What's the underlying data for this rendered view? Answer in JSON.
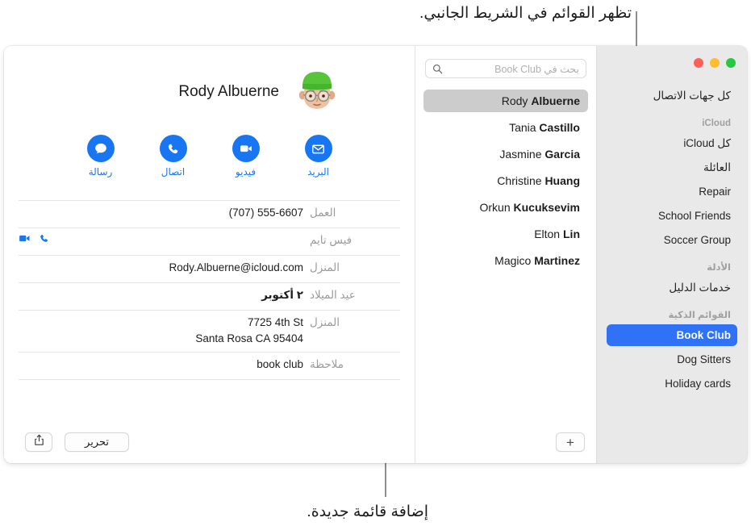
{
  "callouts": {
    "top": "تظهر القوائم في الشريط الجانبي.",
    "bottom": "إضافة قائمة جديدة."
  },
  "window": {
    "traffic_lights": [
      {
        "name": "close",
        "color": "#28c840"
      },
      {
        "name": "minimize",
        "color": "#febc2e"
      },
      {
        "name": "zoom",
        "color": "#ff5f57"
      }
    ]
  },
  "sidebar": {
    "all_contacts": "كل جهات الاتصال",
    "groups": [
      {
        "header": "iCloud",
        "items": [
          {
            "label": "كل iCloud",
            "selected": false
          },
          {
            "label": "العائلة",
            "selected": false
          },
          {
            "label": "Repair",
            "selected": false
          },
          {
            "label": "School Friends",
            "selected": false
          },
          {
            "label": "Soccer Group",
            "selected": false
          }
        ]
      },
      {
        "header": "الأدلة",
        "items": [
          {
            "label": "خدمات الدليل",
            "selected": false
          }
        ]
      },
      {
        "header": "القوائم الذكية",
        "items": [
          {
            "label": "Book Club",
            "selected": true
          },
          {
            "label": "Dog Sitters",
            "selected": false
          },
          {
            "label": "Holiday cards",
            "selected": false
          }
        ]
      }
    ]
  },
  "search": {
    "placeholder": "بحث في Book Club",
    "value": "",
    "icon": "search-icon"
  },
  "contacts": [
    {
      "first": "Rody",
      "last": "Albuerne",
      "selected": true
    },
    {
      "first": "Tania",
      "last": "Castillo",
      "selected": false
    },
    {
      "first": "Jasmine",
      "last": "Garcia",
      "selected": false
    },
    {
      "first": "Christine",
      "last": "Huang",
      "selected": false
    },
    {
      "first": "Orkun",
      "last": "Kucuksevim",
      "selected": false
    },
    {
      "first": "Elton",
      "last": "Lin",
      "selected": false
    },
    {
      "first": "Magico",
      "last": "Martinez",
      "selected": false
    }
  ],
  "detail": {
    "name": "Rody Albuerne",
    "avatar": "memoji-avatar",
    "actions": [
      {
        "label": "البريد",
        "icon": "mail-icon"
      },
      {
        "label": "فيديو",
        "icon": "video-icon"
      },
      {
        "label": "اتصال",
        "icon": "phone-icon"
      },
      {
        "label": "رسالة",
        "icon": "message-icon"
      }
    ],
    "fields": [
      {
        "label": "العمل",
        "value": "(707) 555-6607",
        "kind": "ltr"
      },
      {
        "label": "فيس تايم",
        "value": "",
        "kind": "facetime"
      },
      {
        "label": "المنزل",
        "value": "Rody.Albuerne@icloud.com",
        "kind": "ltr"
      },
      {
        "label": "عيد الميلاد",
        "value": "٢ أكتوبر",
        "kind": "rtl-bold"
      },
      {
        "label": "المنزل",
        "value": "7725 4th St\nSanta Rosa CA 95404",
        "kind": "address"
      },
      {
        "label": "ملاحظة",
        "value": "book club",
        "kind": "ltr"
      }
    ]
  },
  "toolbar": {
    "edit_label": "تحرير",
    "share_icon": "share-icon",
    "add_list_label": "+",
    "add_list_icon": "plus-icon"
  },
  "colors": {
    "accent_blue": "#1876f2",
    "selection_blue": "#2f72f5",
    "list_selection_gray": "#cccccc",
    "sidebar_bg": "#e9e9e9",
    "label_gray": "#9b9b9b"
  }
}
